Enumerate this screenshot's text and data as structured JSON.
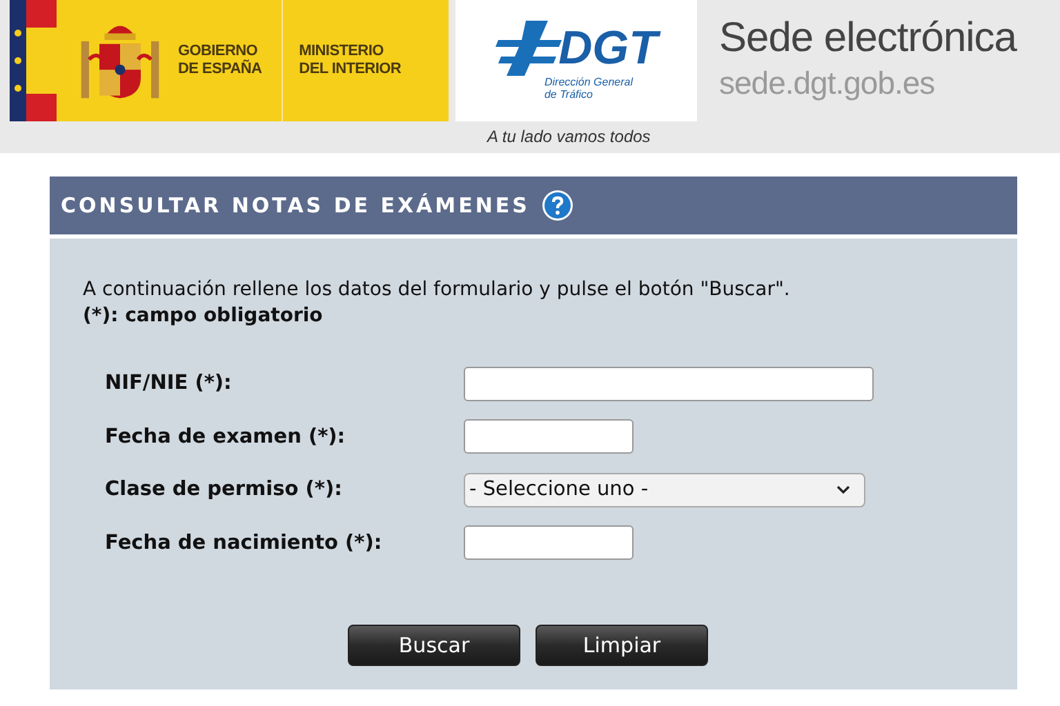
{
  "header": {
    "government_lines": [
      "GOBIERNO",
      "DE ESPAÑA"
    ],
    "ministry_lines": [
      "MINISTERIO",
      "DEL INTERIOR"
    ],
    "dgt": {
      "abbr": "DGT",
      "name_lines": [
        "Dirección General",
        "de Tráfico"
      ]
    },
    "tagline": "A tu lado vamos todos",
    "site_title": "Sede electrónica",
    "site_url": "sede.dgt.gob.es"
  },
  "form": {
    "title": "CONSULTAR NOTAS DE EXÁMENES",
    "intro": "A continuación rellene los datos del formulario y pulse el botón \"Buscar\".",
    "required_note": "(*): campo obligatorio",
    "fields": [
      {
        "label": "NIF/NIE (*):",
        "kind": "text-wide"
      },
      {
        "label": "Fecha de examen (*):",
        "kind": "text-short"
      },
      {
        "label": "Clase de permiso (*):",
        "kind": "select",
        "value": "- Seleccione uno -"
      },
      {
        "label": "Fecha de nacimiento (*):",
        "kind": "text-short"
      }
    ],
    "buttons": [
      "Buscar",
      "Limpiar"
    ]
  }
}
